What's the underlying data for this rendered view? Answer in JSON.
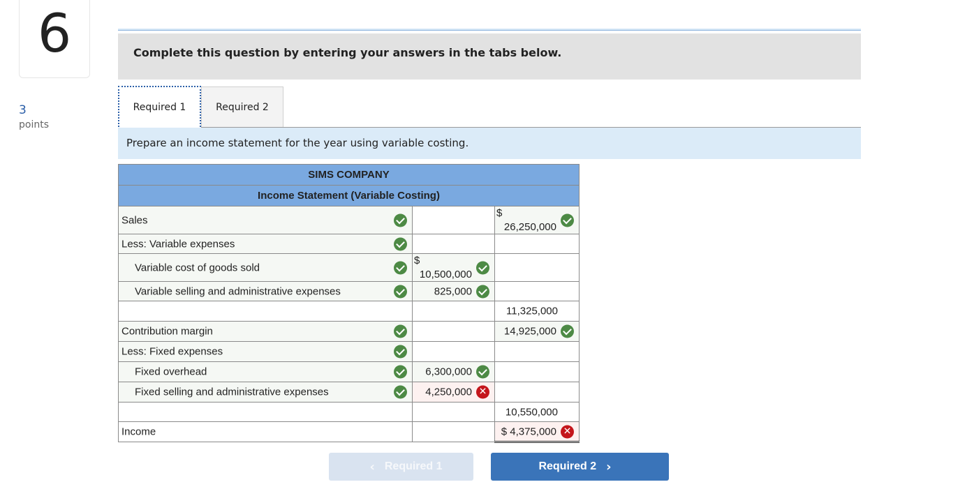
{
  "question": {
    "number": "6",
    "points_value": "3",
    "points_label": "points"
  },
  "instructions": "Complete this question by entering your answers in the tabs below.",
  "tabs": [
    {
      "label": "Required 1",
      "active": true
    },
    {
      "label": "Required 2",
      "active": false
    }
  ],
  "prompt": "Prepare an income statement for the year using variable costing.",
  "statement": {
    "company": "SIMS COMPANY",
    "title": "Income Statement (Variable Costing)",
    "rows": [
      {
        "label": "Sales",
        "label_status": "correct",
        "mid": "",
        "right_dollar": "$",
        "right": "26,250,000",
        "right_status": "correct"
      },
      {
        "label": "Less: Variable expenses",
        "label_status": "correct",
        "mid": "",
        "right": ""
      },
      {
        "label": "Variable cost of goods sold",
        "label_status": "correct",
        "mid_dollar": "$",
        "mid": "10,500,000",
        "mid_status": "correct",
        "right": ""
      },
      {
        "label": "Variable selling and administrative expenses",
        "label_status": "correct",
        "mid": "825,000",
        "mid_status": "correct",
        "right": ""
      },
      {
        "label": "",
        "mid": "",
        "right": "11,325,000"
      },
      {
        "label": "Contribution margin",
        "label_status": "correct",
        "mid": "",
        "right": "14,925,000",
        "right_status": "correct"
      },
      {
        "label": "Less: Fixed expenses",
        "label_status": "correct",
        "mid": "",
        "right": ""
      },
      {
        "label": "Fixed overhead",
        "label_status": "correct",
        "mid": "6,300,000",
        "mid_status": "correct",
        "right": ""
      },
      {
        "label": "Fixed selling and administrative expenses",
        "label_status": "correct",
        "mid": "4,250,000",
        "mid_status": "incorrect",
        "right": ""
      },
      {
        "label": "",
        "mid": "",
        "right": "10,550,000"
      },
      {
        "label": "Income",
        "mid": "",
        "right": "$ 4,375,000",
        "right_status": "incorrect"
      }
    ]
  },
  "nav": {
    "prev_label": "Required 1",
    "next_label": "Required 2",
    "prev_icon": "chevron-left-icon",
    "next_icon": "chevron-right-icon"
  },
  "colors": {
    "header_blue": "#7aa9e0",
    "correct_green": "#4d8a45",
    "incorrect_red": "#c4161c",
    "next_button": "#3a74b9"
  }
}
